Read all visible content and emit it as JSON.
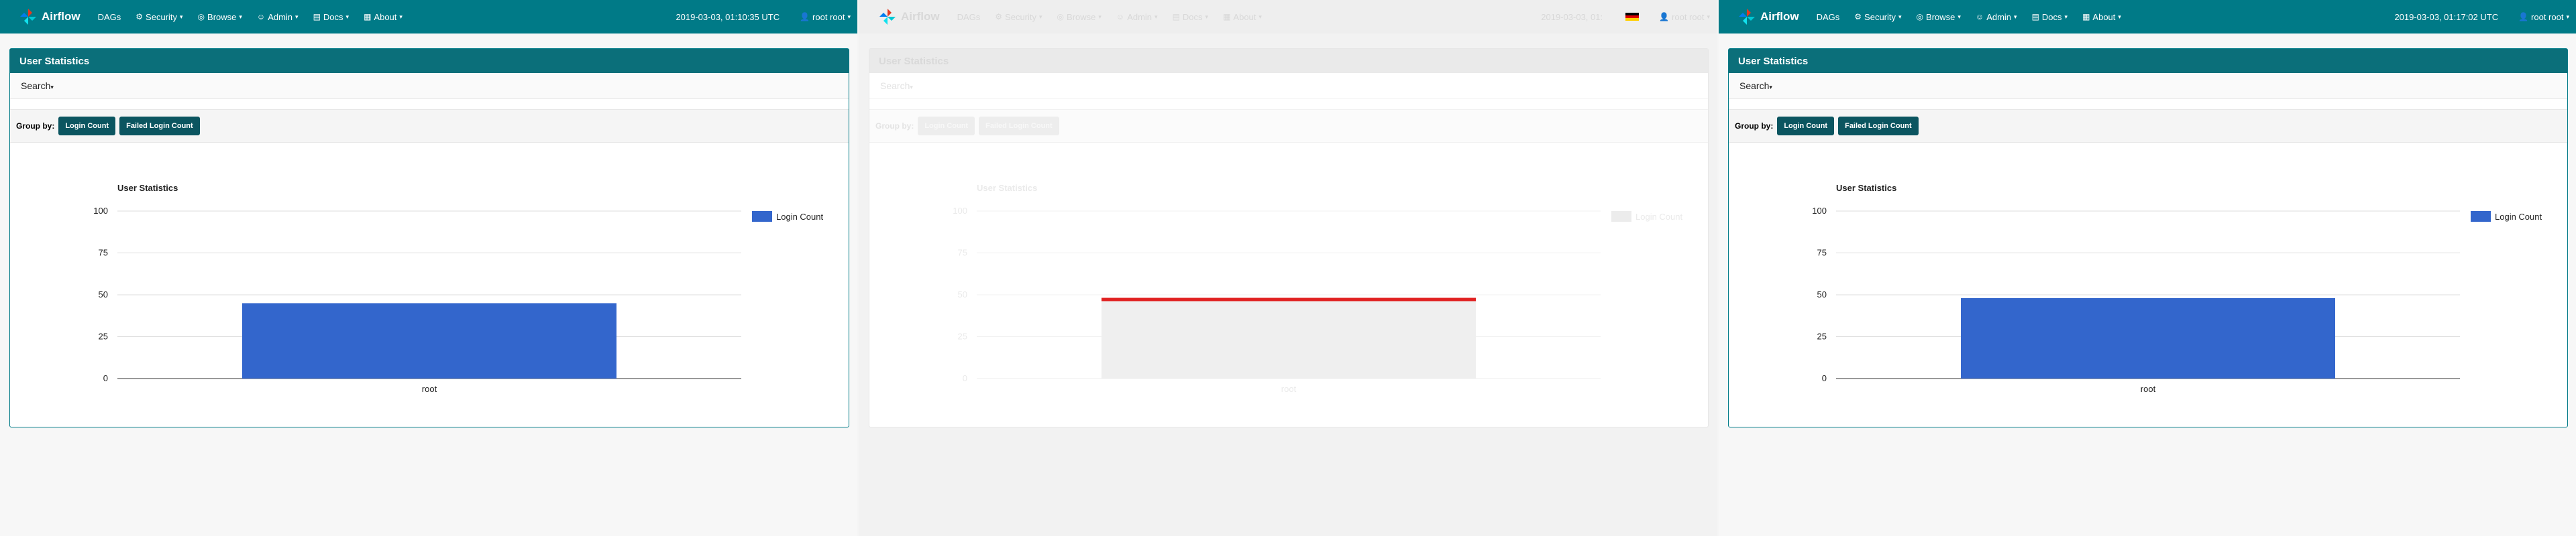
{
  "colors": {
    "navbar": "#007a87",
    "card_header": "#0b6f7a",
    "button": "#0b5560",
    "bar": "#3366cc",
    "highlight_line": "#e02020"
  },
  "panels": [
    {
      "nav": {
        "brand": "Airflow",
        "items": [
          {
            "label": "DAGs",
            "icon": "",
            "caret": false
          },
          {
            "label": "Security",
            "icon": "gears-icon",
            "caret": true
          },
          {
            "label": "Browse",
            "icon": "globe-icon",
            "caret": true
          },
          {
            "label": "Admin",
            "icon": "user-icon",
            "caret": true
          },
          {
            "label": "Docs",
            "icon": "book-icon",
            "caret": true
          },
          {
            "label": "About",
            "icon": "grid-icon",
            "caret": true
          }
        ],
        "datetime": "2019-03-03, 01:10:35 UTC",
        "user": "root root"
      },
      "card": {
        "title": "User Statistics",
        "search_label": "Search",
        "groupby_label": "Group by:",
        "groupby_buttons": [
          "Login Count",
          "Failed Login Count"
        ]
      }
    },
    {
      "nav": {
        "brand": "Airflow",
        "items": [
          {
            "label": "DAGs",
            "icon": "",
            "caret": false
          },
          {
            "label": "Security",
            "icon": "gears-icon",
            "caret": true
          },
          {
            "label": "Browse",
            "icon": "globe-icon",
            "caret": true
          },
          {
            "label": "Admin",
            "icon": "user-icon",
            "caret": true
          },
          {
            "label": "Docs",
            "icon": "book-icon",
            "caret": true
          },
          {
            "label": "About",
            "icon": "grid-icon",
            "caret": true
          }
        ],
        "datetime": "2019-03-03, 01:",
        "user": "root root"
      },
      "card": {
        "title": "User Statistics",
        "search_label": "Search",
        "groupby_label": "Group by:",
        "groupby_buttons": [
          "Login Count",
          "Failed Login Count"
        ]
      }
    },
    {
      "nav": {
        "brand": "Airflow",
        "items": [
          {
            "label": "DAGs",
            "icon": "",
            "caret": false
          },
          {
            "label": "Security",
            "icon": "gears-icon",
            "caret": true
          },
          {
            "label": "Browse",
            "icon": "globe-icon",
            "caret": true
          },
          {
            "label": "Admin",
            "icon": "user-icon",
            "caret": true
          },
          {
            "label": "Docs",
            "icon": "book-icon",
            "caret": true
          },
          {
            "label": "About",
            "icon": "grid-icon",
            "caret": true
          }
        ],
        "datetime": "2019-03-03, 01:17:02 UTC",
        "user": "root root"
      },
      "card": {
        "title": "User Statistics",
        "search_label": "Search",
        "groupby_label": "Group by:",
        "groupby_buttons": [
          "Login Count",
          "Failed Login Count"
        ]
      }
    }
  ],
  "chart_data": [
    {
      "type": "bar",
      "title": "User Statistics",
      "categories": [
        "root"
      ],
      "series": [
        {
          "name": "Login Count",
          "values": [
            45
          ]
        }
      ],
      "yticks": [
        0,
        25,
        50,
        75,
        100
      ],
      "ylim": [
        0,
        100
      ],
      "legend": "top-right",
      "grid": true
    },
    {
      "type": "bar",
      "title": "User Statistics",
      "categories": [
        "root"
      ],
      "series": [
        {
          "name": "Login Count",
          "values": [
            47
          ]
        }
      ],
      "yticks": [
        0,
        25,
        50,
        75,
        100
      ],
      "ylim": [
        0,
        100
      ],
      "legend": "top-right",
      "grid": true
    },
    {
      "type": "bar",
      "title": "User Statistics",
      "categories": [
        "root"
      ],
      "series": [
        {
          "name": "Login Count",
          "values": [
            48
          ]
        }
      ],
      "yticks": [
        0,
        25,
        50,
        75,
        100
      ],
      "ylim": [
        0,
        100
      ],
      "legend": "top-right",
      "grid": true
    }
  ]
}
